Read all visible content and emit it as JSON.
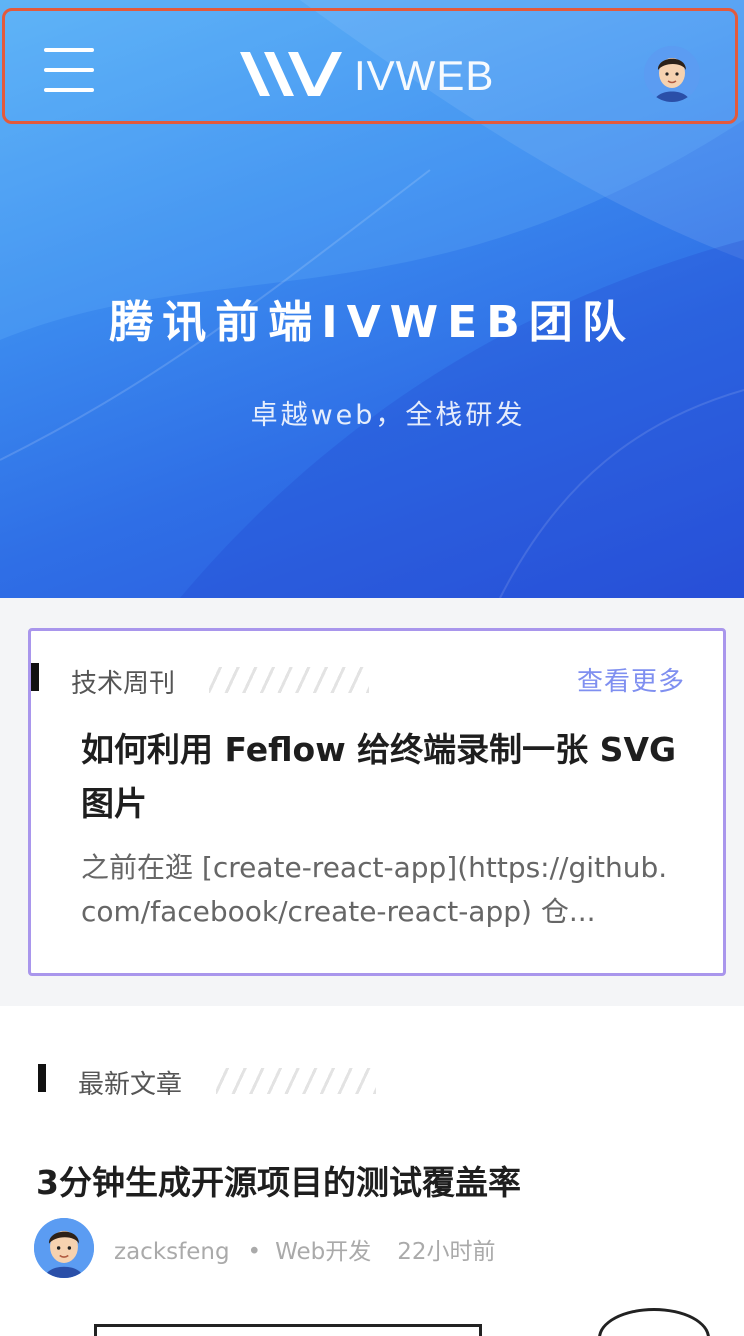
{
  "header": {
    "logo_text": "IVWEB",
    "menu_icon": "hamburger-menu-icon",
    "avatar_icon": "user-avatar"
  },
  "hero": {
    "title": "腾讯前端IVWEB团队",
    "subtitle": "卓越web，全栈研发"
  },
  "weekly": {
    "section_label": "技术周刊",
    "more_label": "查看更多",
    "article_title": "如何利用 Feflow 给终端录制一张 SVG 图片",
    "article_desc": "之前在逛 [create-react-app](https://github.com/facebook/create-react-app) 仓..."
  },
  "latest": {
    "section_label": "最新文章",
    "articles": [
      {
        "title": "3分钟生成开源项目的测试覆盖率",
        "author": "zacksfeng",
        "category": "Web开发",
        "time": "22小时前"
      }
    ]
  },
  "colors": {
    "hero_blue": "#3d8ef0",
    "highlight_border": "#e35a3c",
    "card_border": "#a996ec",
    "link": "#7f8ff0"
  }
}
